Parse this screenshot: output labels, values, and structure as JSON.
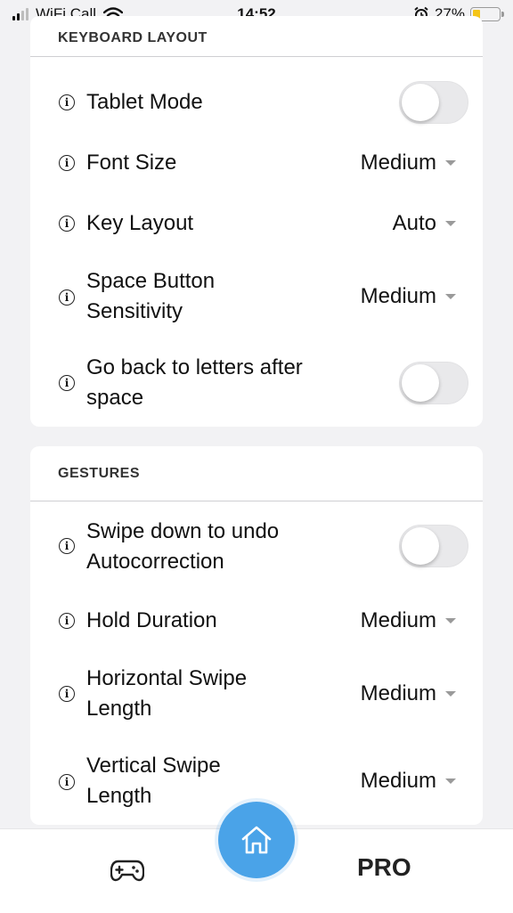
{
  "status_bar": {
    "carrier": "WiFi Call",
    "time": "14:52",
    "battery": "27%"
  },
  "keyboard_layout": {
    "title": "KEYBOARD LAYOUT",
    "tablet_mode": "Tablet Mode",
    "font_size": {
      "label": "Font Size",
      "value": "Medium"
    },
    "key_layout": {
      "label": "Key Layout",
      "value": "Auto"
    },
    "space_sensitivity": {
      "label1": "Space Button",
      "label2": "Sensitivity",
      "value": "Medium"
    },
    "back_to_letters": {
      "label1": "Go back to letters after",
      "label2": "space"
    }
  },
  "gestures": {
    "title": "GESTURES",
    "swipe_undo": {
      "label1": "Swipe down to undo",
      "label2": "Autocorrection"
    },
    "hold_duration": {
      "label": "Hold Duration",
      "value": "Medium"
    },
    "horizontal_swipe": {
      "label1": "Horizontal Swipe",
      "label2": "Length",
      "value": "Medium"
    },
    "vertical_swipe": {
      "label1": "Vertical Swipe",
      "label2": "Length",
      "value": "Medium"
    }
  },
  "tab_bar": {
    "pro_label": "PRO"
  },
  "icons": [
    "signal-icon",
    "wifi-icon",
    "alarm-icon",
    "battery-icon",
    "info-icon",
    "chevron-down-icon",
    "home-icon",
    "gamepad-icon"
  ],
  "colors": {
    "accent": "#4aa3e8",
    "battery": "#f5c518",
    "background": "#f2f2f4"
  }
}
